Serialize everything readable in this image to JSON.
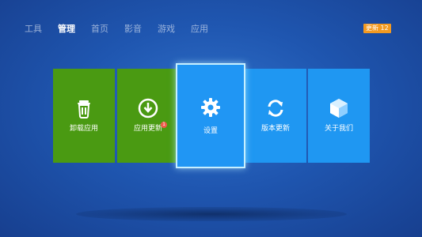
{
  "nav": {
    "tabs": [
      {
        "label": "工具",
        "active": false
      },
      {
        "label": "管理",
        "active": true
      },
      {
        "label": "首页",
        "active": false
      },
      {
        "label": "影音",
        "active": false
      },
      {
        "label": "游戏",
        "active": false
      },
      {
        "label": "应用",
        "active": false
      }
    ],
    "update_badge": "更新 12"
  },
  "tiles": [
    {
      "label": "卸载应用",
      "icon": "trash-icon",
      "color": "#4a9a12",
      "selected": false
    },
    {
      "label": "应用更新",
      "icon": "download-icon",
      "color": "#4a9a12",
      "selected": false,
      "badge": "1"
    },
    {
      "label": "设置",
      "icon": "gear-icon",
      "color": "#2096f4",
      "selected": true
    },
    {
      "label": "版本更新",
      "icon": "refresh-icon",
      "color": "#1f97f2",
      "selected": false
    },
    {
      "label": "关于我们",
      "icon": "box-icon",
      "color": "#1f97f2",
      "selected": false
    }
  ],
  "colors": {
    "background": "#1f56b0",
    "green_tile": "#4a9a12",
    "blue_tile": "#1f97f2",
    "badge": "#f39a21",
    "selected_border": "#c6efff"
  }
}
